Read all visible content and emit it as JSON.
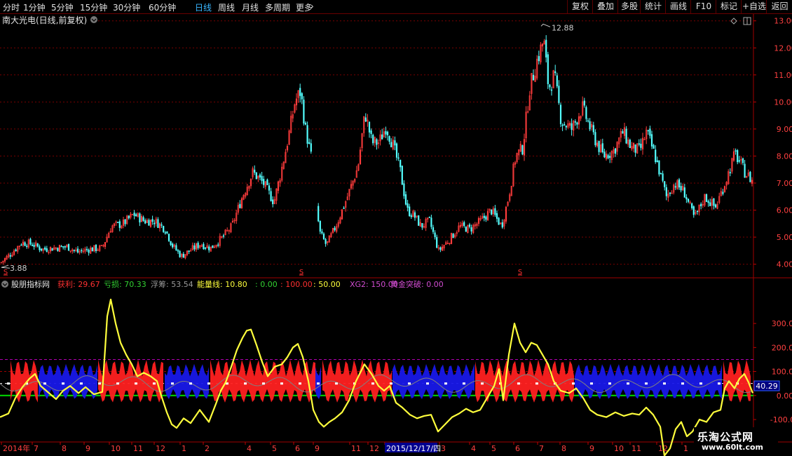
{
  "toolbar": {
    "timeframes": [
      "分时",
      "1分钟",
      "5分钟",
      "15分钟",
      "30分钟",
      "60分钟",
      "日线",
      "周线",
      "月线",
      "多周期",
      "更多"
    ],
    "active": "日线",
    "more_arrow": "›",
    "right_buttons": [
      "复权",
      "叠加",
      "多股",
      "统计",
      "画线",
      "F10",
      "标记",
      "+自选",
      "返回"
    ]
  },
  "main_panel": {
    "title": "南大光电(日线,前复权)",
    "max_label": "12.88",
    "min_label": "3.88",
    "event_marker": "S",
    "y_ticks": [
      "13.00",
      "12.00",
      "11.00",
      "10.00",
      "9.00",
      "8.00",
      "7.00",
      "6.00",
      "5.00",
      "4.00"
    ]
  },
  "indicator_panel": {
    "name": "股朋指标网",
    "legend": [
      {
        "text": "获利: 29.67",
        "color": "#ff3030"
      },
      {
        "text": "亏损: 70.33",
        "color": "#32d232"
      },
      {
        "text": "浮筹: 53.54",
        "color": "#9a9a9a"
      },
      {
        "text": "能量线: 10.80",
        "color": "#ffff3c"
      },
      {
        "text": ": 0.00",
        "color": "#32d232"
      },
      {
        "text": ": 100.00",
        "color": "#ff3030"
      },
      {
        "text": ": 50.00",
        "color": "#ffff3c"
      },
      {
        "text": "XG2: 150.00",
        "color": "#d04cd0"
      },
      {
        "text": "黄金突破: 0.00",
        "color": "#d04cd0"
      }
    ],
    "y_ticks": [
      "300.00",
      "200.00",
      "100.00",
      "0.00",
      "-100.00"
    ],
    "current_value": "40.29"
  },
  "time_axis": {
    "labels": [
      "2014年",
      "7",
      "8",
      "9",
      "10",
      "11",
      "12",
      "1",
      "2",
      "4",
      "5",
      "6",
      "9",
      "11",
      "12",
      "2015/12/17/四",
      "3",
      "4",
      "5",
      "6",
      "7",
      "8",
      "9",
      "10",
      "11",
      "12",
      "1"
    ]
  },
  "watermark": {
    "line1": "乐淘公式网",
    "line2": "www.60lt.com"
  },
  "colors": {
    "up": "#ff3c3c",
    "down": "#54ffff",
    "energy": "#ffff3c",
    "profit": "#ff2020",
    "loss": "#1818e8",
    "float": "#808080",
    "zero": "#00e000",
    "grid": "#7a0000"
  },
  "chart_data": [
    {
      "type": "candlestick",
      "title": "南大光电(日线,前复权)",
      "ylim": [
        3.6,
        13.2
      ],
      "y_ticks": [
        13,
        12,
        11,
        10,
        9,
        8,
        7,
        6,
        5,
        4
      ],
      "max": 12.88,
      "min": 3.88,
      "close_path": [
        [
          0,
          4.05
        ],
        [
          15,
          4.4
        ],
        [
          30,
          4.8
        ],
        [
          45,
          4.75
        ],
        [
          60,
          4.55
        ],
        [
          75,
          4.6
        ],
        [
          95,
          4.65
        ],
        [
          110,
          4.45
        ],
        [
          125,
          4.55
        ],
        [
          145,
          4.6
        ],
        [
          158,
          5.4
        ],
        [
          175,
          5.5
        ],
        [
          190,
          5.85
        ],
        [
          205,
          5.6
        ],
        [
          220,
          5.6
        ],
        [
          235,
          5.3
        ],
        [
          245,
          4.7
        ],
        [
          258,
          4.3
        ],
        [
          270,
          4.5
        ],
        [
          285,
          4.75
        ],
        [
          300,
          4.6
        ],
        [
          315,
          4.95
        ],
        [
          330,
          5.4
        ],
        [
          345,
          6.5
        ],
        [
          360,
          7.4
        ],
        [
          375,
          7.0
        ],
        [
          390,
          6.3
        ],
        [
          400,
          7.4
        ],
        [
          410,
          8.6
        ],
        [
          420,
          10.0
        ],
        [
          428,
          10.4
        ],
        [
          435,
          9.0
        ],
        [
          443,
          8.0
        ],
        [
          455,
          5.2
        ],
        [
          465,
          4.7
        ],
        [
          480,
          5.5
        ],
        [
          495,
          6.5
        ],
        [
          510,
          7.6
        ],
        [
          520,
          9.6
        ],
        [
          530,
          8.5
        ],
        [
          540,
          8.5
        ],
        [
          550,
          9.1
        ],
        [
          560,
          8.4
        ],
        [
          570,
          7.5
        ],
        [
          580,
          6.0
        ],
        [
          590,
          5.8
        ],
        [
          600,
          5.4
        ],
        [
          612,
          5.6
        ],
        [
          625,
          4.5
        ],
        [
          640,
          4.9
        ],
        [
          655,
          5.4
        ],
        [
          670,
          5.3
        ],
        [
          685,
          5.6
        ],
        [
          700,
          6.0
        ],
        [
          715,
          5.4
        ],
        [
          725,
          6.5
        ],
        [
          735,
          8.0
        ],
        [
          745,
          8.3
        ],
        [
          755,
          10.5
        ],
        [
          765,
          11.5
        ],
        [
          775,
          12.3
        ],
        [
          782,
          10.5
        ],
        [
          790,
          11.0
        ],
        [
          800,
          9.3
        ],
        [
          815,
          9.0
        ],
        [
          830,
          9.8
        ],
        [
          845,
          8.8
        ],
        [
          860,
          8.0
        ],
        [
          875,
          8.2
        ],
        [
          888,
          8.9
        ],
        [
          900,
          8.3
        ],
        [
          912,
          8.2
        ],
        [
          922,
          8.9
        ],
        [
          935,
          7.9
        ],
        [
          950,
          6.5
        ],
        [
          962,
          7.0
        ],
        [
          975,
          6.7
        ],
        [
          990,
          5.7
        ],
        [
          1005,
          6.5
        ],
        [
          1020,
          6.1
        ],
        [
          1035,
          7.1
        ],
        [
          1048,
          8.1
        ],
        [
          1062,
          7.4
        ],
        [
          1075,
          7.0
        ]
      ],
      "event_markers_x": [
        8,
        430,
        742
      ]
    },
    {
      "type": "indicator",
      "name": "股朋指标网",
      "ylim": [
        -170,
        420
      ],
      "y_ticks": [
        300,
        200,
        100,
        0,
        -100
      ],
      "reference_lines": [
        0,
        50,
        100,
        150
      ],
      "series": [
        {
          "name": "能量线",
          "color": "#ffff3c",
          "points": [
            [
              0,
              -90
            ],
            [
              12,
              -75
            ],
            [
              22,
              -10
            ],
            [
              32,
              35
            ],
            [
              42,
              70
            ],
            [
              50,
              90
            ],
            [
              58,
              40
            ],
            [
              70,
              10
            ],
            [
              80,
              -15
            ],
            [
              90,
              20
            ],
            [
              100,
              40
            ],
            [
              112,
              10
            ],
            [
              122,
              35
            ],
            [
              134,
              5
            ],
            [
              146,
              15
            ],
            [
              153,
              330
            ],
            [
              158,
              400
            ],
            [
              165,
              300
            ],
            [
              172,
              220
            ],
            [
              180,
              170
            ],
            [
              188,
              130
            ],
            [
              196,
              80
            ],
            [
              205,
              95
            ],
            [
              215,
              80
            ],
            [
              224,
              60
            ],
            [
              230,
              0
            ],
            [
              238,
              -70
            ],
            [
              245,
              -120
            ],
            [
              252,
              -135
            ],
            [
              262,
              -95
            ],
            [
              272,
              -115
            ],
            [
              285,
              -60
            ],
            [
              298,
              -110
            ],
            [
              308,
              -35
            ],
            [
              315,
              20
            ],
            [
              322,
              55
            ],
            [
              330,
              120
            ],
            [
              338,
              190
            ],
            [
              346,
              240
            ],
            [
              352,
              270
            ],
            [
              358,
              275
            ],
            [
              366,
              210
            ],
            [
              374,
              140
            ],
            [
              382,
              80
            ],
            [
              392,
              120
            ],
            [
              402,
              130
            ],
            [
              410,
              160
            ],
            [
              418,
              200
            ],
            [
              425,
              215
            ],
            [
              432,
              160
            ],
            [
              440,
              60
            ],
            [
              447,
              -60
            ],
            [
              455,
              -110
            ],
            [
              462,
              -130
            ],
            [
              470,
              -110
            ],
            [
              478,
              -95
            ],
            [
              488,
              -70
            ],
            [
              498,
              -20
            ],
            [
              508,
              60
            ],
            [
              520,
              130
            ],
            [
              530,
              90
            ],
            [
              540,
              40
            ],
            [
              548,
              20
            ],
            [
              556,
              40
            ],
            [
              565,
              -30
            ],
            [
              574,
              -50
            ],
            [
              585,
              -80
            ],
            [
              595,
              -95
            ],
            [
              605,
              -85
            ],
            [
              615,
              -80
            ],
            [
              625,
              -150
            ],
            [
              635,
              -120
            ],
            [
              645,
              -90
            ],
            [
              655,
              -75
            ],
            [
              665,
              -55
            ],
            [
              675,
              -70
            ],
            [
              685,
              -60
            ],
            [
              695,
              -10
            ],
            [
              705,
              40
            ],
            [
              712,
              110
            ],
            [
              718,
              -20
            ],
            [
              726,
              170
            ],
            [
              734,
              300
            ],
            [
              742,
              220
            ],
            [
              750,
              180
            ],
            [
              758,
              220
            ],
            [
              766,
              210
            ],
            [
              774,
              170
            ],
            [
              782,
              130
            ],
            [
              790,
              60
            ],
            [
              800,
              20
            ],
            [
              812,
              10
            ],
            [
              822,
              30
            ],
            [
              832,
              -10
            ],
            [
              842,
              -60
            ],
            [
              852,
              -80
            ],
            [
              865,
              -90
            ],
            [
              878,
              -70
            ],
            [
              890,
              -85
            ],
            [
              902,
              -75
            ],
            [
              912,
              -80
            ],
            [
              922,
              -50
            ],
            [
              932,
              -80
            ],
            [
              942,
              -130
            ],
            [
              948,
              -250
            ],
            [
              956,
              -220
            ],
            [
              964,
              -140
            ],
            [
              972,
              -110
            ],
            [
              980,
              -170
            ],
            [
              988,
              -150
            ],
            [
              998,
              -100
            ],
            [
              1008,
              -110
            ],
            [
              1018,
              -70
            ],
            [
              1028,
              -60
            ],
            [
              1034,
              30
            ],
            [
              1040,
              60
            ],
            [
              1048,
              30
            ],
            [
              1055,
              70
            ],
            [
              1062,
              90
            ],
            [
              1068,
              55
            ],
            [
              1074,
              10
            ]
          ]
        },
        {
          "name": "获利",
          "color": "#ff2020",
          "segments": [
            [
              15,
              55
            ],
            [
              140,
              235
            ],
            [
              300,
              450
            ],
            [
              460,
              560
            ],
            [
              678,
              820
            ],
            [
              1032,
              1072
            ]
          ]
        },
        {
          "name": "亏损",
          "color": "#1818e8",
          "segments": [
            [
              55,
              140
            ],
            [
              235,
              300
            ],
            [
              440,
              460
            ],
            [
              560,
              678
            ],
            [
              820,
              1032
            ]
          ]
        },
        {
          "name": "浮筹",
          "color": "#808080"
        }
      ]
    }
  ]
}
